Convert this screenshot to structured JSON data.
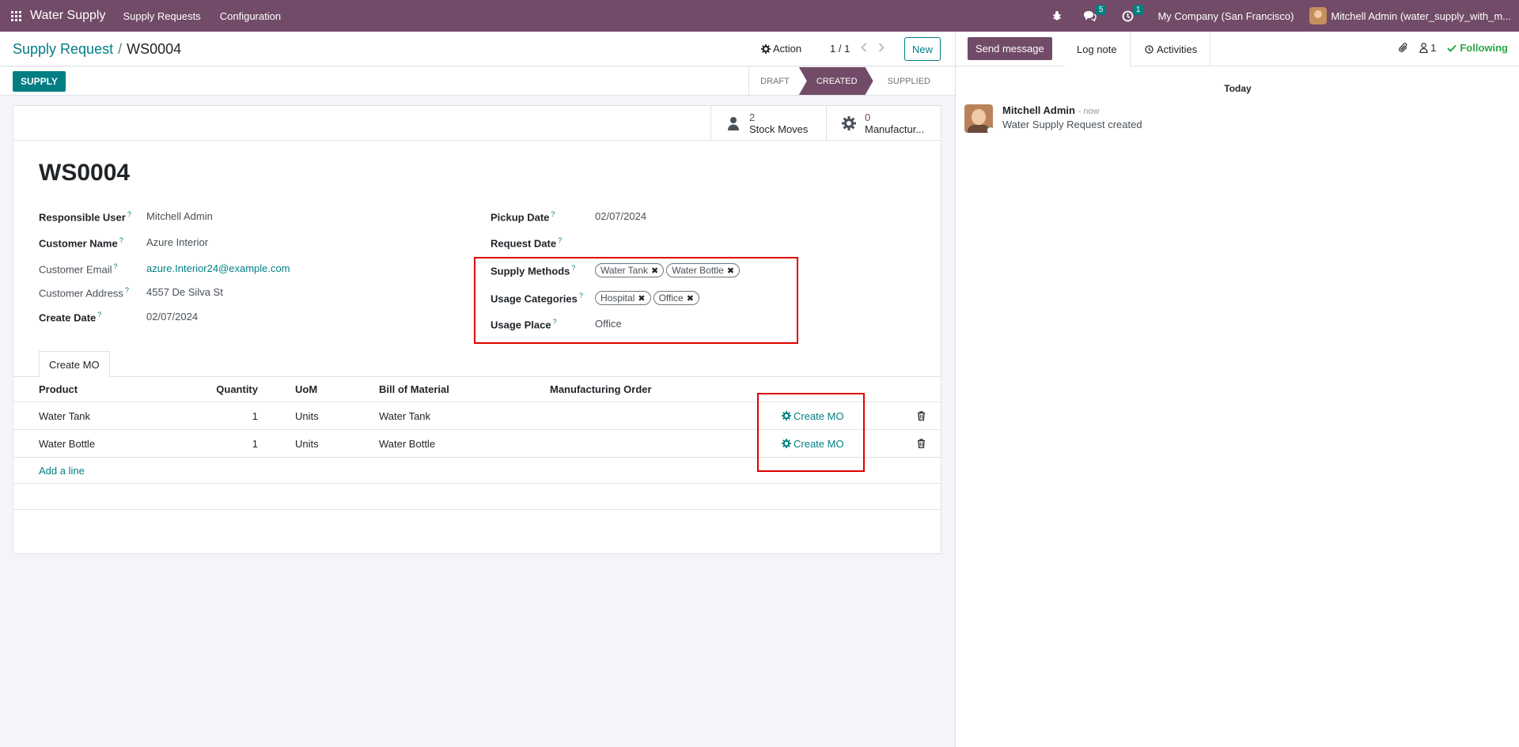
{
  "navbar": {
    "app_name": "Water Supply",
    "menus": [
      "Supply Requests",
      "Configuration"
    ],
    "messages_count": "5",
    "activities_count": "1",
    "company": "My Company (San Francisco)",
    "user": "Mitchell Admin (water_supply_with_m..."
  },
  "control": {
    "breadcrumb_parent": "Supply Request",
    "breadcrumb_separator": "/",
    "breadcrumb_current": "WS0004",
    "action_label": "Action",
    "pager": "1 / 1",
    "new_label": "New"
  },
  "statusbar": {
    "supply_label": "SUPPLY",
    "stages": [
      "DRAFT",
      "CREATED",
      "SUPPLIED"
    ],
    "active_stage": "CREATED"
  },
  "stat_buttons": {
    "stock_moves_count": "2",
    "stock_moves_label": "Stock Moves",
    "manufacturing_count": "0",
    "manufacturing_label": "Manufactur..."
  },
  "record": {
    "title": "WS0004",
    "fields_left": {
      "responsible_user_label": "Responsible User",
      "responsible_user": "Mitchell Admin",
      "customer_name_label": "Customer Name",
      "customer_name": "Azure Interior",
      "customer_email_label": "Customer Email",
      "customer_email": "azure.Interior24@example.com",
      "customer_address_label": "Customer Address",
      "customer_address": "4557 De Silva St",
      "create_date_label": "Create Date",
      "create_date": "02/07/2024"
    },
    "fields_right": {
      "pickup_date_label": "Pickup Date",
      "pickup_date": "02/07/2024",
      "request_date_label": "Request Date",
      "supply_methods_label": "Supply Methods",
      "supply_methods": [
        "Water Tank",
        "Water Bottle"
      ],
      "usage_categories_label": "Usage Categories",
      "usage_categories": [
        "Hospital",
        "Office"
      ],
      "usage_place_label": "Usage Place",
      "usage_place": "Office"
    },
    "help_mark": "?"
  },
  "tab": {
    "label": "Create MO"
  },
  "table": {
    "headers": [
      "Product",
      "Quantity",
      "UoM",
      "Bill of Material",
      "Manufacturing Order"
    ],
    "rows": [
      {
        "product": "Water Tank",
        "quantity": "1",
        "uom": "Units",
        "bom": "Water Tank",
        "mo": "",
        "button": "Create MO"
      },
      {
        "product": "Water Bottle",
        "quantity": "1",
        "uom": "Units",
        "bom": "Water Bottle",
        "mo": "",
        "button": "Create MO"
      }
    ],
    "add_line": "Add a line"
  },
  "chatter": {
    "send_message": "Send message",
    "log_note": "Log note",
    "activities": "Activities",
    "followers_count": "1",
    "following": "Following",
    "date_separator": "Today",
    "message": {
      "author": "Mitchell Admin",
      "time": "- now",
      "body": "Water Supply Request created"
    }
  },
  "colors": {
    "brand": "#714b67",
    "accent": "#017e84",
    "following": "#28a745",
    "highlight_box": "#e00000"
  }
}
